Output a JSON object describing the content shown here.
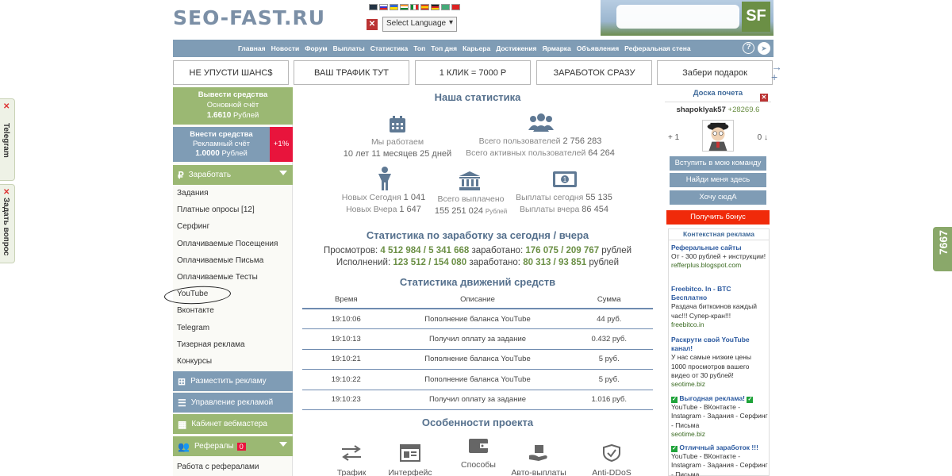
{
  "side_tabs": {
    "telegram": "Telegram",
    "ask": "Задать вопрос",
    "counter": "7667"
  },
  "header": {
    "logo": "SEO-FAST.RU",
    "language": "Select Language",
    "banner_text": "SF"
  },
  "nav": {
    "items": [
      "Главная",
      "Новости",
      "Форум",
      "Выплаты",
      "Статистика",
      "Топ",
      "Топ дня",
      "Карьера",
      "Достижения",
      "Ярмарка",
      "Объявления",
      "Реферальная стена"
    ],
    "help": "?"
  },
  "promos": [
    "НЕ УПУСТИ ШАНС$",
    "ВАШ ТРАФИК ТУТ",
    "1 КЛИК = 7000 Р",
    "ЗАРАБОТОК СРАЗУ",
    "Забери подарок"
  ],
  "sidebar": {
    "withdraw": {
      "title": "Вывести средства",
      "sub": "Основной счёт",
      "amount": "1.6610",
      "unit": "Рублей"
    },
    "deposit": {
      "title": "Внести средства",
      "sub": "Рекламный счёт",
      "amount": "1.0000",
      "unit": "Рублей",
      "bonus": "+1%"
    },
    "earn_label": "Заработать",
    "earn_items": [
      "Задания",
      "Платные опросы [12]",
      "Серфинг",
      "Оплачиваемые Посещения",
      "Оплачиваемые Письма",
      "Оплачиваемые Тесты",
      "YouTube",
      "Вконтакте",
      "Telegram",
      "Тизерная реклама",
      "Конкурсы"
    ],
    "place_ad": "Разместить рекламу",
    "manage_ad": "Управление рекламой",
    "webmaster": "Кабинет вебмастера",
    "referrals": "Рефералы",
    "referrals_count": "0",
    "ref_work": "Работа с рефералами"
  },
  "main": {
    "stats_title": "Наша статистика",
    "working_label": "Мы работаем",
    "working_value": "10 лет 11 месяцев 25 дней",
    "users_total_label": "Всего пользователей",
    "users_total": "2 756 283",
    "users_active_label": "Всего активных пользователей",
    "users_active": "64 264",
    "new_today_label": "Новых Сегодня",
    "new_today": "1 041",
    "new_yesterday_label": "Новых Вчера",
    "new_yesterday": "1 647",
    "paid_total_label": "Всего выплачено",
    "paid_total": "155 251 024",
    "paid_unit": "Рублей",
    "pay_today_label": "Выплаты сегодня",
    "pay_today": "55 135",
    "pay_yesterday_label": "Выплаты вчера",
    "pay_yesterday": "86 454",
    "earn_title": "Статистика по заработку за сегодня / вчера",
    "views_label": "Просмотров:",
    "views": "4 512 984 / 5 341 668",
    "earned_label": "заработано:",
    "views_earned": "176 075 / 209 767",
    "rub": "рублей",
    "exec_label": "Исполнений:",
    "exec": "123 512 / 154 080",
    "exec_earned": "80 313 / 93 851",
    "moves_title": "Статистика движений средств",
    "table_headers": [
      "Время",
      "Описание",
      "Сумма"
    ],
    "table_rows": [
      [
        "19:10:06",
        "Пополнение баланса YouTube",
        "44 руб."
      ],
      [
        "19:10:13",
        "Получил оплату за задание",
        "0.432 руб."
      ],
      [
        "19:10:21",
        "Пополнение баланса YouTube",
        "5 руб."
      ],
      [
        "19:10:22",
        "Пополнение баланса YouTube",
        "5 руб."
      ],
      [
        "19:10:23",
        "Получил оплату за задание",
        "1.016 руб."
      ]
    ],
    "features_title": "Особенности проекта",
    "features": [
      "Трафик",
      "Интерфейс",
      "Способы",
      "Авто-выплаты",
      "Anti-DDoS"
    ]
  },
  "right": {
    "honor_title": "Доска почета",
    "user": "shapoklyak57",
    "score": "+28269.6",
    "left_vote": "+ 1",
    "right_vote": "0 ↓",
    "btn_team": "Вступить в мою команду",
    "btn_find": "Найди меня здесь",
    "btn_want": "Хочу сюдА",
    "btn_bonus": "Получить бонус",
    "ads_title": "Контекстная реклама",
    "ads": [
      {
        "title": "Реферальные сайты",
        "text": "От - 300 рублей + инструкции!",
        "link": "refferplus.blogspot.com"
      },
      {
        "title": "Freebitco. In - BTC Бесплатно",
        "text": "Раздача биткоинов каждый час!!! Супер-кран!!!",
        "link": "freebitco.in"
      },
      {
        "title": "Раскрути свой YouTube канал!",
        "text": "У нас самые низкие цены 1000 просмотров вашего видео от 30 рублей!",
        "link": "seotime.biz"
      },
      {
        "title": "Выгодная реклама!",
        "text": "YouTube - ВКонтакте - Instagram - Задания - Серфинг - Письма",
        "link": "seotime.biz"
      },
      {
        "title": "Отличный заработок !!!",
        "text": "YouTube - ВКонтакте - Instagram - Задания - Серфинг - Письма",
        "link": ""
      }
    ]
  }
}
